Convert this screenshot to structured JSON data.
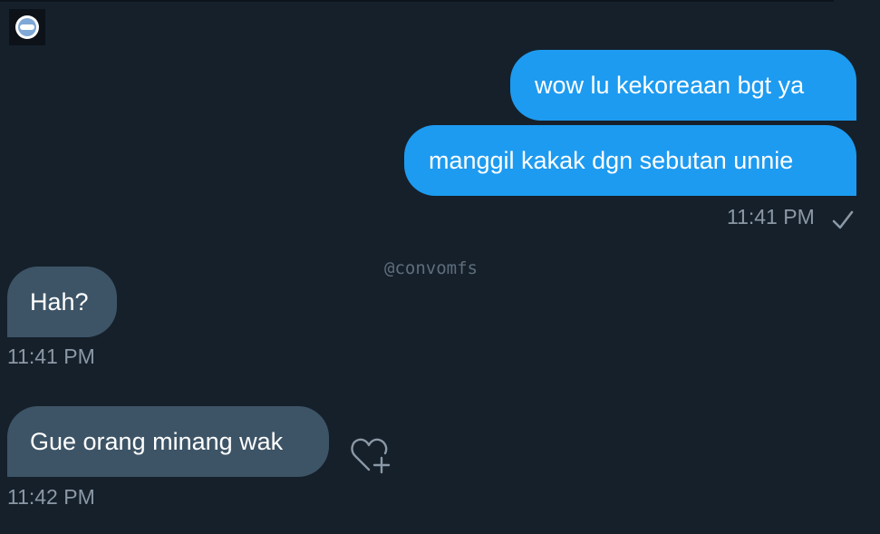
{
  "watermark": "@convomfs",
  "messages": [
    {
      "direction": "sent",
      "text": "wow lu kekoreaan bgt ya"
    },
    {
      "direction": "sent",
      "text": "manggil kakak dgn sebutan unnie",
      "time": "11:41 PM",
      "status_icon": "check-icon"
    },
    {
      "direction": "received",
      "text": "Hah?",
      "time": "11:41 PM"
    },
    {
      "direction": "received",
      "text": "Gue orang minang wak",
      "time": "11:42 PM",
      "reaction_icon": "heart-plus-icon"
    }
  ],
  "colors": {
    "background": "#15202b",
    "sent_bubble": "#1d9bf0",
    "received_bubble": "#3d5466",
    "timestamp": "#8b98a5",
    "watermark": "#5f6e7c"
  }
}
